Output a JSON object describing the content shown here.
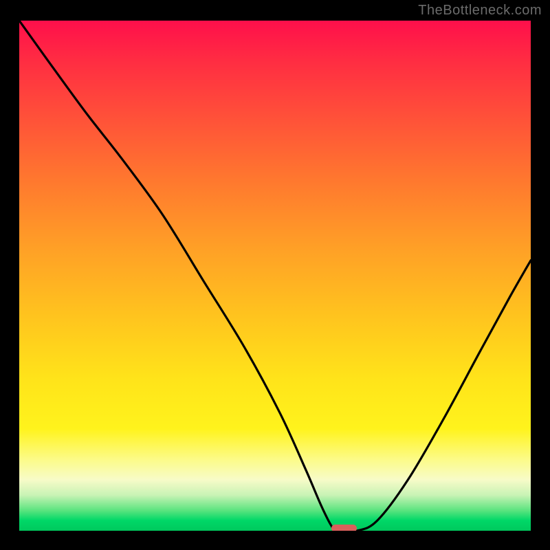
{
  "watermark": "TheBottleneck.com",
  "colors": {
    "frame": "#000000",
    "curve": "#000000",
    "marker": "#d9605b",
    "gradient_top": "#ff0f4b",
    "gradient_mid1": "#ffa126",
    "gradient_mid2": "#ffe31a",
    "gradient_bottom": "#00c85d"
  },
  "chart_data": {
    "type": "line",
    "title": "",
    "xlabel": "",
    "ylabel": "",
    "xlim": [
      0,
      100
    ],
    "ylim": [
      0,
      100
    ],
    "grid": false,
    "legend": false,
    "annotations": [],
    "background_gradient": "red-to-green vertical",
    "series": [
      {
        "name": "bottleneck-curve",
        "x": [
          0,
          5,
          13,
          20,
          28,
          36,
          44,
          51,
          56,
          59,
          61,
          62,
          66,
          70,
          76,
          83,
          90,
          96,
          100
        ],
        "y": [
          100,
          93,
          82,
          73,
          62,
          49,
          36,
          23,
          12,
          5,
          1,
          0,
          0,
          2,
          10,
          22,
          35,
          46,
          53
        ]
      }
    ],
    "marker": {
      "x_start": 61,
      "x_end": 66,
      "y": 0,
      "shape": "rounded-bar"
    }
  }
}
